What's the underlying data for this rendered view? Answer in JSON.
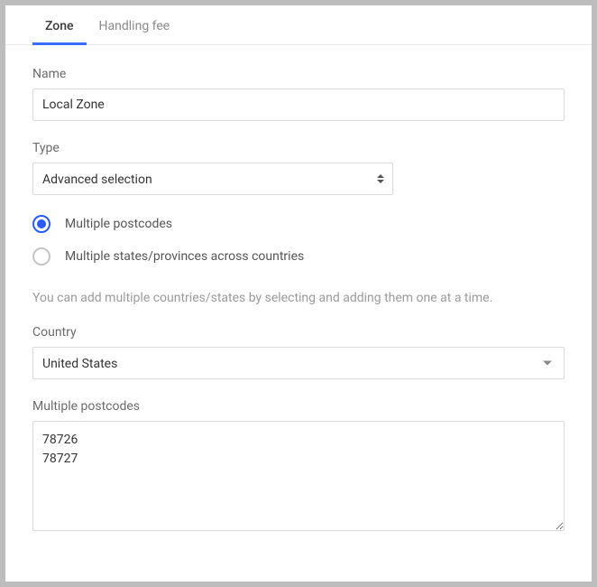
{
  "tabs": {
    "zone": "Zone",
    "handling_fee": "Handling fee"
  },
  "name": {
    "label": "Name",
    "value": "Local Zone"
  },
  "type": {
    "label": "Type",
    "value": "Advanced selection"
  },
  "radios": {
    "postcodes": "Multiple postcodes",
    "states": "Multiple states/provinces across countries"
  },
  "hint": "You can add multiple countries/states by selecting and adding them one at a time.",
  "country": {
    "label": "Country",
    "value": "United States"
  },
  "postcodes": {
    "label": "Multiple postcodes",
    "value": "78726\n78727"
  }
}
